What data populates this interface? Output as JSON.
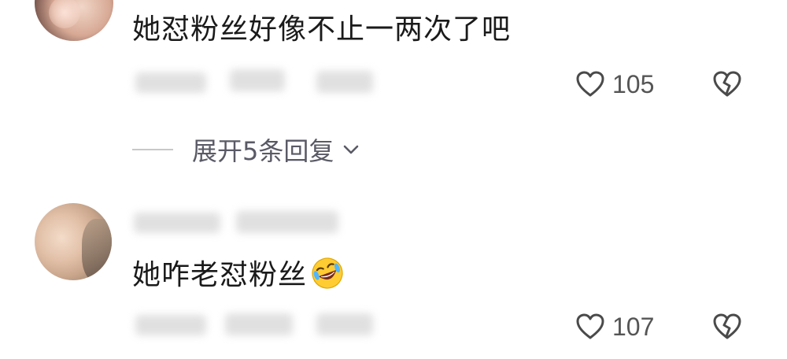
{
  "comments": [
    {
      "text": "她怼粉丝好像不止一两次了吧",
      "like_count": "105",
      "expand_label": "展开5条回复"
    },
    {
      "text": "她咋老怼粉丝",
      "emoji": "rolling-on-floor-laughing-emoji",
      "like_count": "107"
    }
  ],
  "icons": {
    "like": "heart-outline-icon",
    "dislike": "broken-heart-icon",
    "expand": "chevron-down-icon"
  },
  "colors": {
    "text": "#1a1a1a",
    "meta": "#555555",
    "expand": "#5a5a66",
    "background": "#ffffff"
  }
}
